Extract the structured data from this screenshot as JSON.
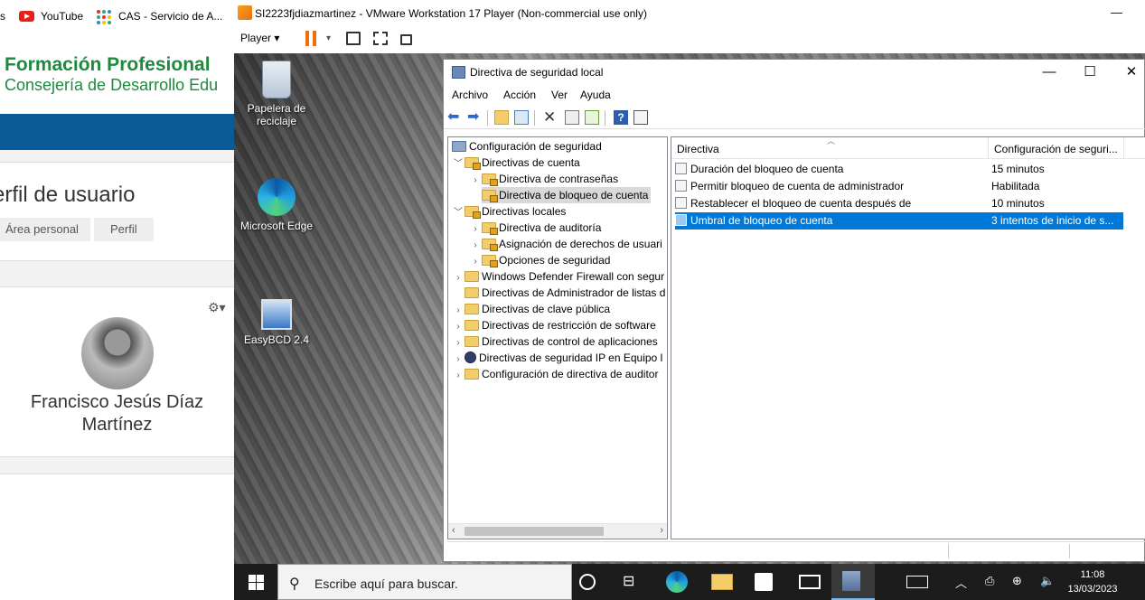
{
  "browser": {
    "bookmarks": [
      {
        "label": "s",
        "icon": "partial-bookmark-icon"
      },
      {
        "label": "YouTube",
        "icon": "youtube-icon"
      },
      {
        "label": "CAS - Servicio de A...",
        "icon": "cas-icon"
      }
    ],
    "site_title": "Formación Profesional",
    "site_subtitle": "Consejería de Desarrollo Edu",
    "page_heading": "erfil de usuario",
    "breadcrumb": [
      "Área personal",
      "Perfil"
    ],
    "user_name": "Francisco Jesús Díaz Martínez"
  },
  "vmware": {
    "title": "SI2223fjdiazmartinez - VMware Workstation 17 Player (Non-commercial use only)",
    "player_menu": "Player",
    "minimize": "—"
  },
  "desktop": {
    "icons": [
      {
        "label": "Papelera de reciclaje",
        "icon": "recycle-bin-icon"
      },
      {
        "label": "Microsoft Edge",
        "icon": "edge-icon"
      },
      {
        "label": "EasyBCD 2.4",
        "icon": "easybcd-icon"
      }
    ]
  },
  "mmc": {
    "title": "Directiva de seguridad local",
    "menu": [
      "Archivo",
      "Acción",
      "Ver",
      "Ayuda"
    ],
    "window_buttons": {
      "minimize": "—",
      "maximize": "☐",
      "close": "✕"
    },
    "tree": [
      {
        "label": "Configuración de seguridad",
        "level": 0,
        "chev": "",
        "folder": "none"
      },
      {
        "label": "Directivas de cuenta",
        "level": 1,
        "chev": "v",
        "folder": "lock"
      },
      {
        "label": "Directiva de contraseñas",
        "level": 2,
        "chev": ">",
        "folder": "lock"
      },
      {
        "label": "Directiva de bloqueo de cuenta",
        "level": 2,
        "chev": "",
        "folder": "lock",
        "selected": true
      },
      {
        "label": "Directivas locales",
        "level": 1,
        "chev": "v",
        "folder": "lock"
      },
      {
        "label": "Directiva de auditoría",
        "level": 2,
        "chev": ">",
        "folder": "lock"
      },
      {
        "label": "Asignación de derechos de usuari",
        "level": 2,
        "chev": ">",
        "folder": "lock"
      },
      {
        "label": "Opciones de seguridad",
        "level": 2,
        "chev": ">",
        "folder": "lock"
      },
      {
        "label": "Windows Defender Firewall con segur",
        "level": 1,
        "chev": ">",
        "folder": "plain"
      },
      {
        "label": "Directivas de Administrador de listas d",
        "level": 1,
        "chev": "",
        "folder": "plain"
      },
      {
        "label": "Directivas de clave pública",
        "level": 1,
        "chev": ">",
        "folder": "plain"
      },
      {
        "label": "Directivas de restricción de software",
        "level": 1,
        "chev": ">",
        "folder": "plain"
      },
      {
        "label": "Directivas de control de aplicaciones",
        "level": 1,
        "chev": ">",
        "folder": "plain"
      },
      {
        "label": "Directivas de seguridad IP en Equipo l",
        "level": 1,
        "chev": ">",
        "folder": "sec"
      },
      {
        "label": "Configuración de directiva de auditor",
        "level": 1,
        "chev": ">",
        "folder": "plain"
      }
    ],
    "list": {
      "columns": [
        "Directiva",
        "Configuración de seguri..."
      ],
      "rows": [
        {
          "policy": "Duración del bloqueo de cuenta",
          "setting": "15 minutos"
        },
        {
          "policy": "Permitir bloqueo de cuenta de administrador",
          "setting": "Habilitada"
        },
        {
          "policy": "Restablecer el bloqueo de cuenta después de",
          "setting": "10 minutos"
        },
        {
          "policy": "Umbral de bloqueo de cuenta",
          "setting": "3 intentos de inicio de s...",
          "selected": true
        }
      ]
    }
  },
  "taskbar": {
    "search_placeholder": "Escribe aquí para buscar.",
    "time": "11:08",
    "date": "13/03/2023",
    "colors": {
      "bg": "#1c1c1c",
      "accent": "#0078d7"
    }
  }
}
